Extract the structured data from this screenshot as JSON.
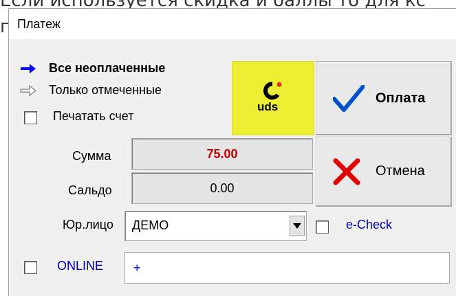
{
  "background": {
    "line1": "Если используется скидка и баллы то для кс",
    "line2_char": "г"
  },
  "window": {
    "title": "Платеж"
  },
  "options": {
    "all_unpaid": "Все неоплаченные",
    "only_marked": "Только отмеченные",
    "print_invoice": "Печатать счет"
  },
  "uds_button": {
    "label": "uds",
    "glyph": "C"
  },
  "pay_button": {
    "label": "Оплата",
    "icon": "checkmark-icon"
  },
  "cancel_button": {
    "label": "Отмена",
    "icon": "x-mark-icon"
  },
  "sum": {
    "label": "Сумма",
    "value": "75.00"
  },
  "balance": {
    "label": "Сальдо",
    "value": "0.00"
  },
  "legal_entity": {
    "label": "Юр.лицо",
    "value": "ДЕМО"
  },
  "echeck": {
    "label": "e-Check"
  },
  "online": {
    "label": "ONLINE",
    "value": "+"
  },
  "colors": {
    "uds_bg": "#eeee33",
    "sum_red": "#c00000",
    "link_blue": "#0000c0",
    "arrow_blue": "#0000ff",
    "check_blue": "#0050d0",
    "cancel_red": "#e00000"
  }
}
